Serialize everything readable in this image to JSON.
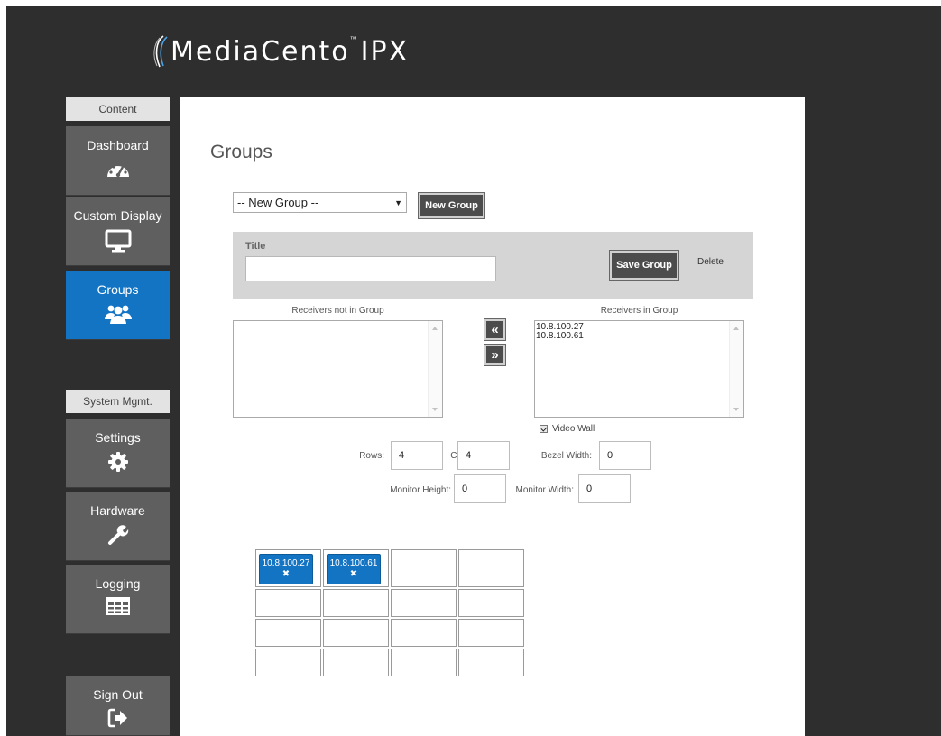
{
  "brand": {
    "name": "MediaCento",
    "tm": "™",
    "suffix": "IPX"
  },
  "sidebar": {
    "content_header": "Content",
    "system_header": "System Mgmt.",
    "items": [
      {
        "label": "Dashboard",
        "icon": "dashboard-gauge-icon"
      },
      {
        "label": "Custom Display",
        "icon": "monitor-icon"
      },
      {
        "label": "Groups",
        "icon": "users-group-icon",
        "active": true
      },
      {
        "label": "Settings",
        "icon": "gear-icon"
      },
      {
        "label": "Hardware",
        "icon": "wrench-icon"
      },
      {
        "label": "Logging",
        "icon": "table-grid-icon"
      },
      {
        "label": "Sign Out",
        "icon": "sign-out-icon"
      }
    ]
  },
  "main": {
    "title": "Groups",
    "group_select": {
      "selected": "-- New Group --"
    },
    "new_group_label": "New Group",
    "title_panel": {
      "label": "Title",
      "value": "",
      "save_label": "Save Group",
      "delete_label": "Delete"
    },
    "receivers_not_in_group": {
      "caption": "Receivers not in Group",
      "items": []
    },
    "receivers_in_group": {
      "caption": "Receivers in Group",
      "items": [
        "10.8.100.27",
        "10.8.100.61"
      ]
    },
    "move_left_label": "«",
    "move_right_label": "»",
    "video_wall": {
      "label": "Video Wall",
      "checked": true
    },
    "rows": {
      "label": "Rows:",
      "value": "4"
    },
    "cols": {
      "label": "Cols:",
      "value": "4"
    },
    "bezel_width": {
      "label": "Bezel Width:",
      "value": "0"
    },
    "monitor_height": {
      "label": "Monitor Height:",
      "value": "0"
    },
    "monitor_width": {
      "label": "Monitor Width:",
      "value": "0"
    },
    "wall_grid": {
      "cells": [
        {
          "label": "10.8.100.27",
          "remove": "✖"
        },
        {
          "label": "10.8.100.61",
          "remove": "✖"
        }
      ]
    }
  },
  "colors": {
    "accent": "#1474c4",
    "sidebar_bg": "#2e2e2e",
    "nav_item": "#5f5f5f"
  }
}
